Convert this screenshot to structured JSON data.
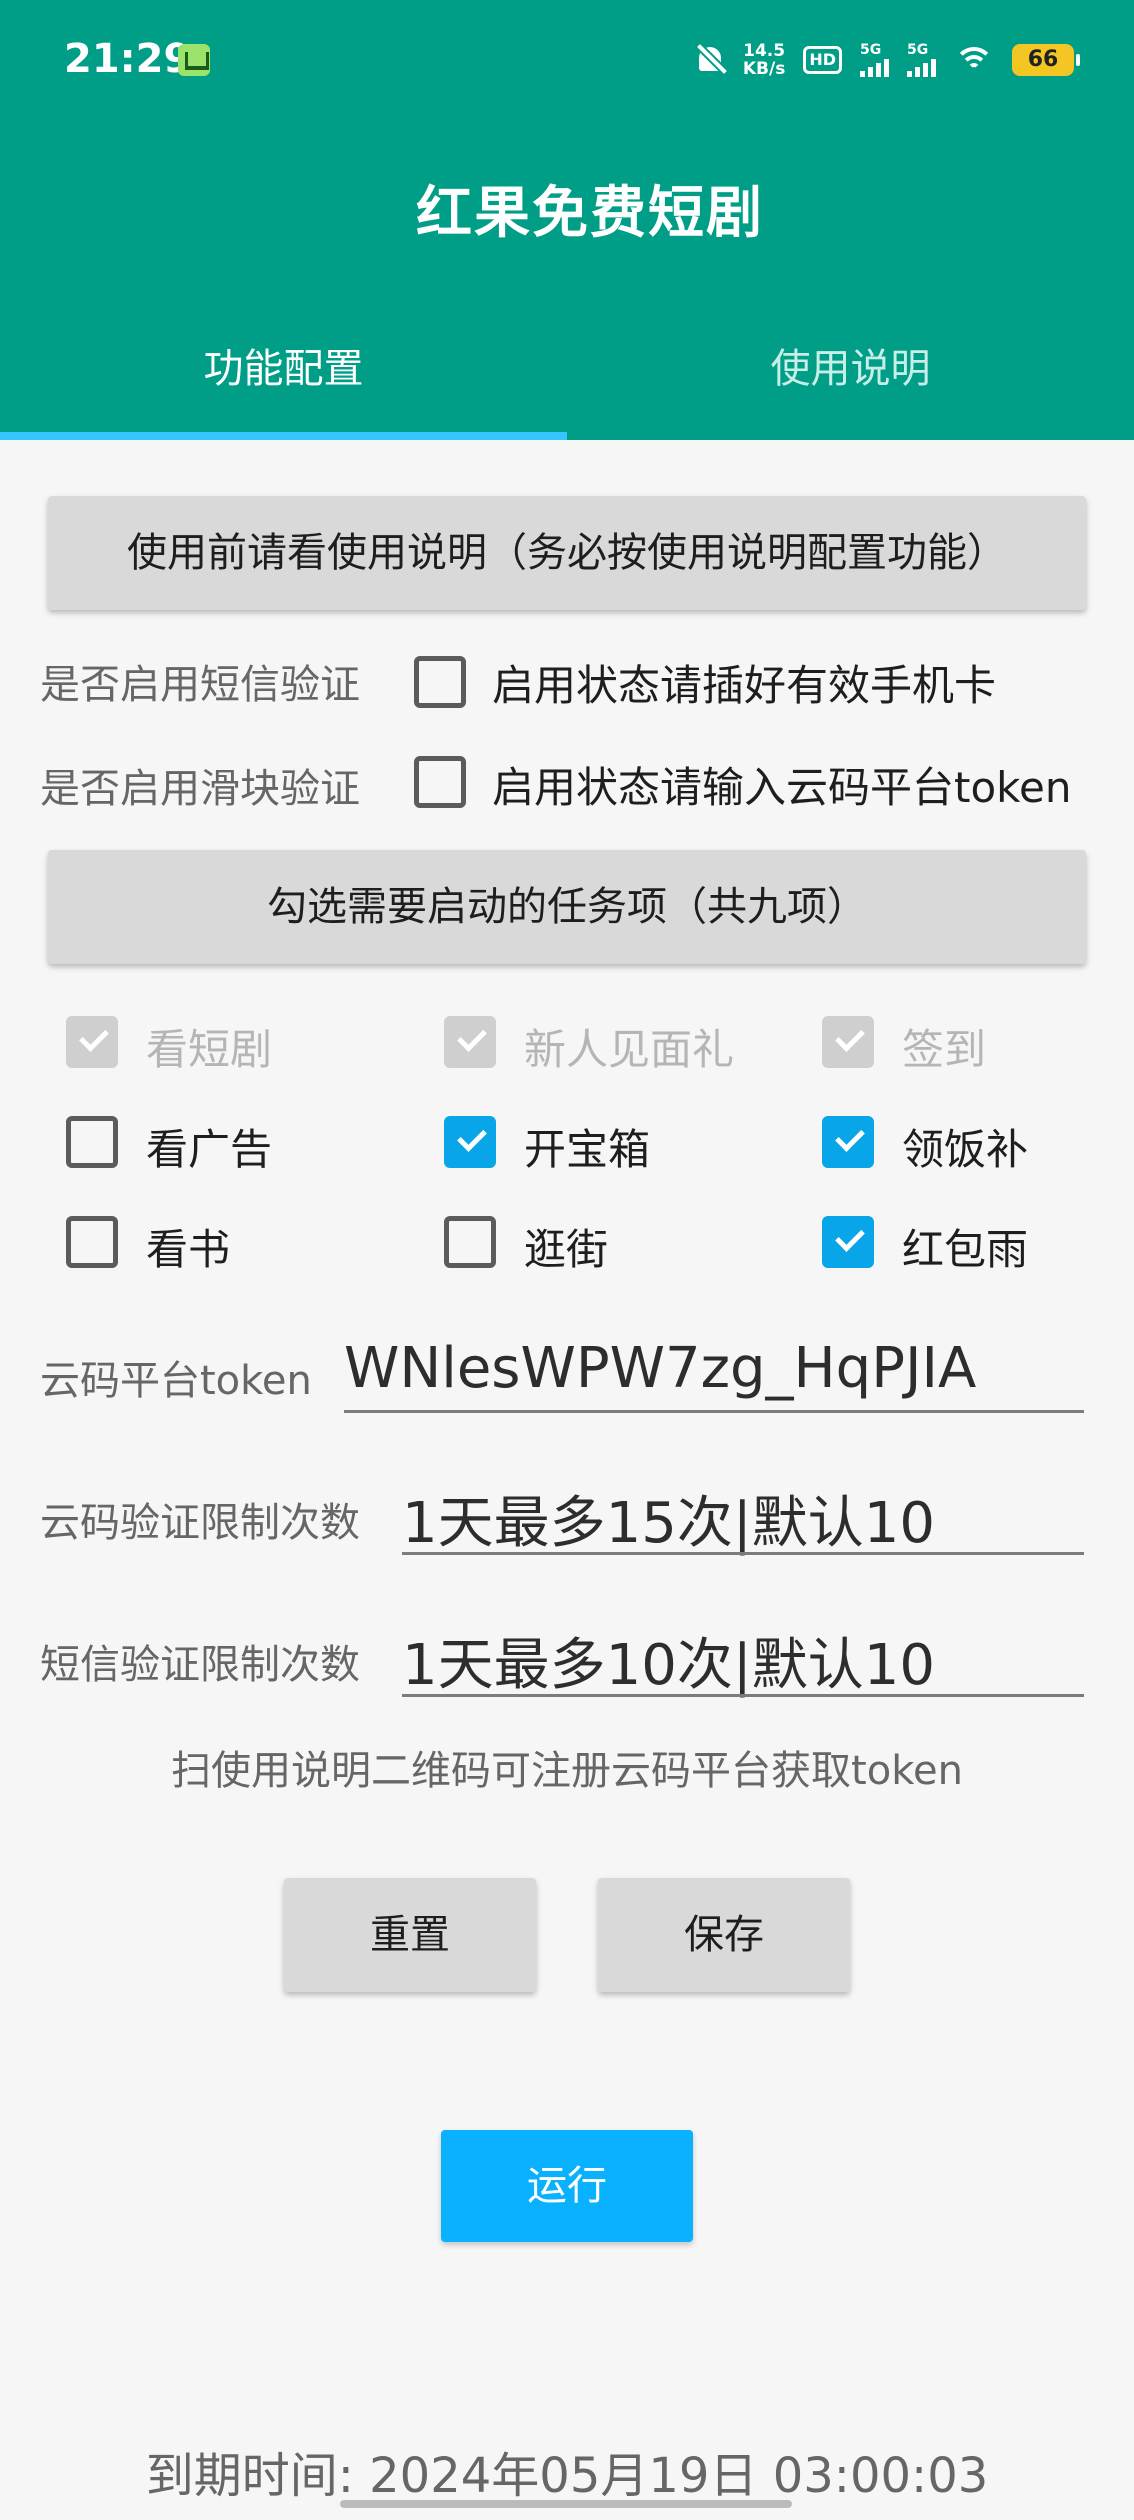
{
  "status_bar": {
    "time": "21:29",
    "net_speed_value": "14.5",
    "net_speed_unit": "KB/s",
    "hd_label": "HD",
    "signal_1": "5G",
    "signal_2": "5G",
    "battery": "66"
  },
  "app": {
    "title": "红果免费短剧"
  },
  "tabs": [
    {
      "label": "功能配置",
      "selected": true
    },
    {
      "label": "使用说明",
      "selected": false
    }
  ],
  "notice_button": {
    "label": "使用前请看使用说明（务必按使用说明配置功能）"
  },
  "sms_verify": {
    "label": "是否启用短信验证",
    "checkbox_text": "启用状态请插好有效手机卡",
    "checked": false
  },
  "slider_verify": {
    "label": "是否启用滑块验证",
    "checkbox_text": "启用状态请输入云码平台token",
    "checked": false
  },
  "tasks_button": {
    "label": "勾选需要启动的任务项（共九项）"
  },
  "tasks": [
    {
      "label": "看短剧",
      "checked": true,
      "enabled": false
    },
    {
      "label": "新人见面礼",
      "checked": true,
      "enabled": false
    },
    {
      "label": "签到",
      "checked": true,
      "enabled": false
    },
    {
      "label": "看广告",
      "checked": false,
      "enabled": true
    },
    {
      "label": "开宝箱",
      "checked": true,
      "enabled": true
    },
    {
      "label": "领饭补",
      "checked": true,
      "enabled": true
    },
    {
      "label": "看书",
      "checked": false,
      "enabled": true
    },
    {
      "label": "逛街",
      "checked": false,
      "enabled": true
    },
    {
      "label": "红包雨",
      "checked": true,
      "enabled": true
    }
  ],
  "fields": {
    "token": {
      "label": "云码平台token",
      "value": "WNlesWPW7zg_HqPJIA"
    },
    "captcha_limit": {
      "label": "云码验证限制次数",
      "value": "1天最多15次|默认10"
    },
    "sms_limit": {
      "label": "短信验证限制次数",
      "value": "1天最多10次|默认10"
    }
  },
  "hint": "扫使用说明二维码可注册云码平台获取token",
  "buttons": {
    "reset": "重置",
    "save": "保存",
    "run": "运行"
  },
  "expire": "到期时间: 2024年05月19日 03:00:03",
  "colors": {
    "primary": "#009e87",
    "accent": "#08a5e8",
    "run": "#0ab1ff",
    "tab_indicator": "#36c6ff"
  }
}
